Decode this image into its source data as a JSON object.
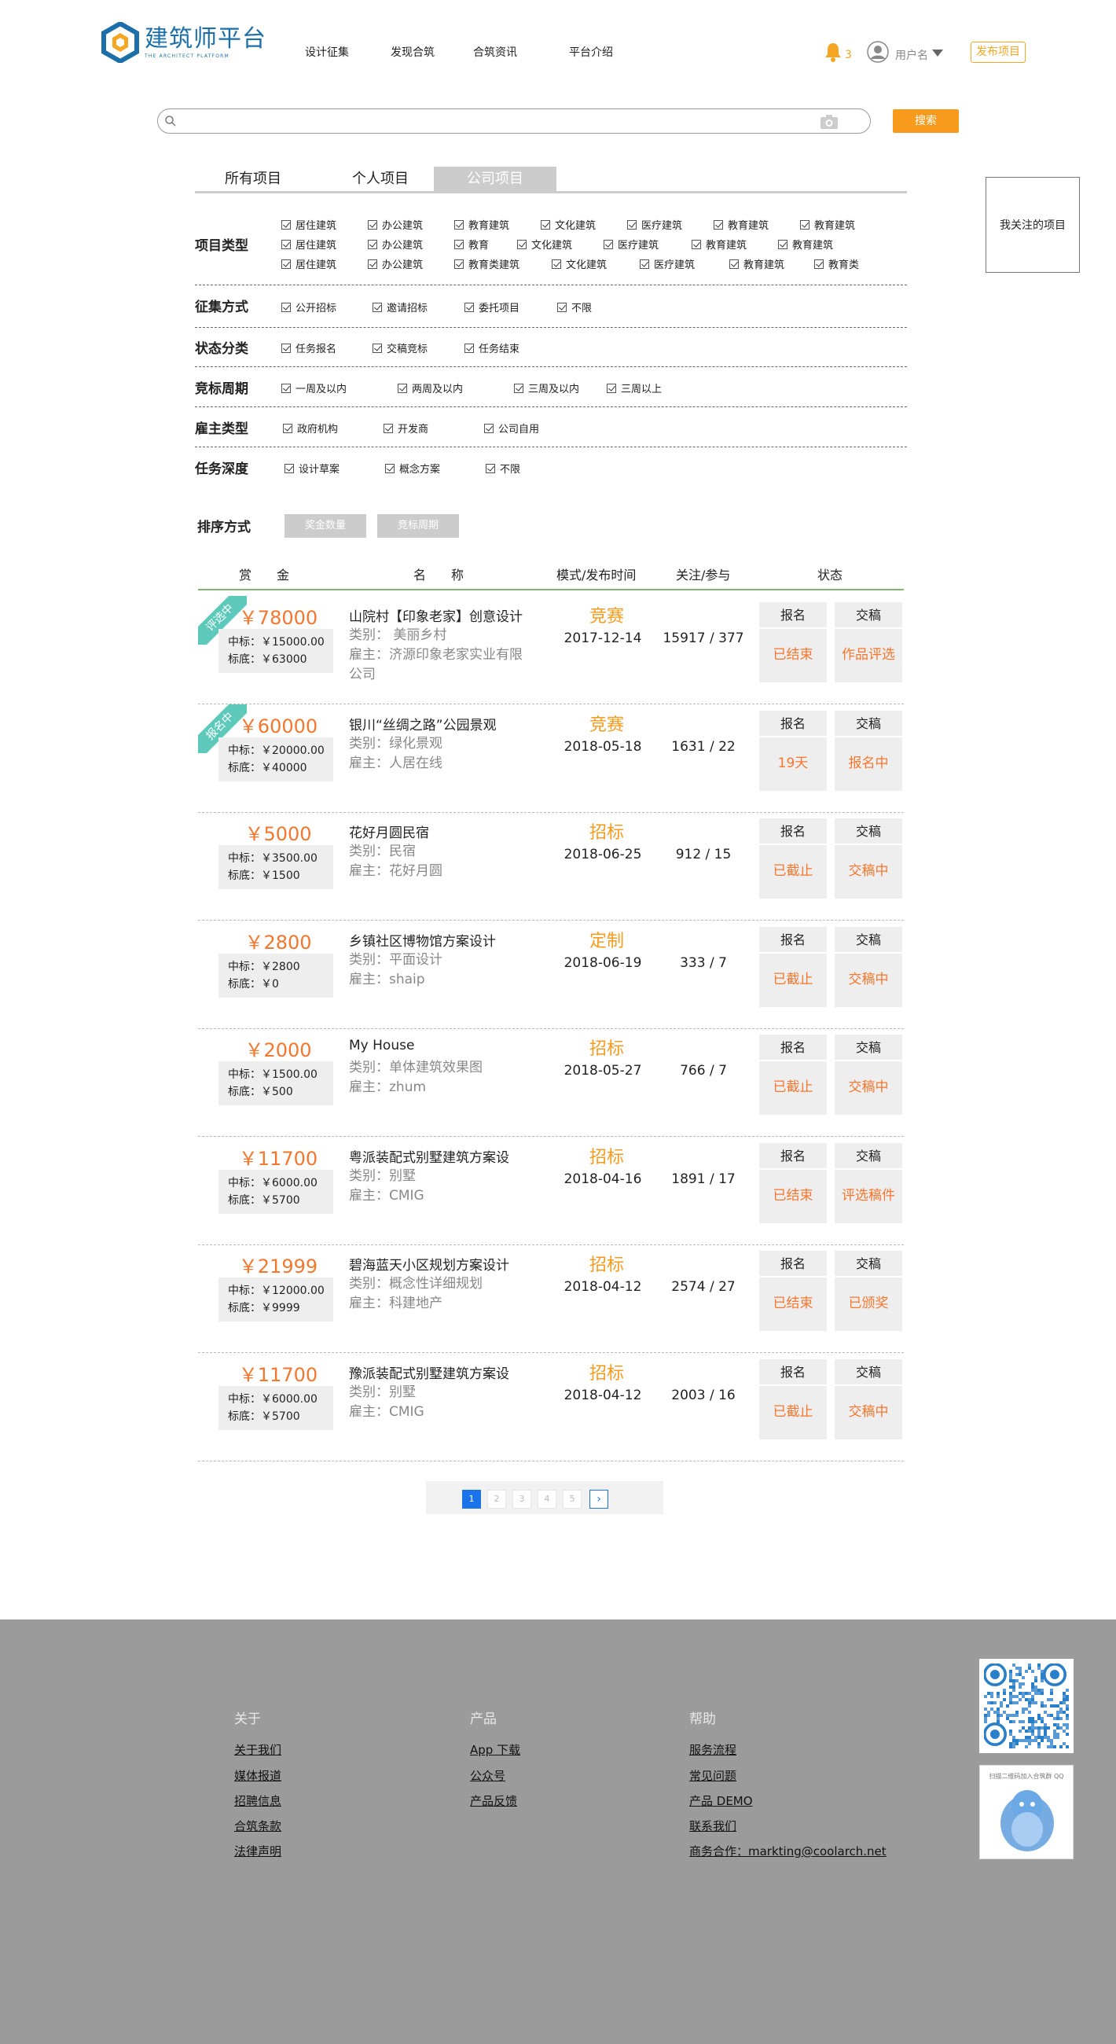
{
  "header": {
    "logo_cn": "建筑师平台",
    "logo_en": "THE ARCHITECT PLATFORM",
    "nav": [
      "设计征集",
      "发现合筑",
      "合筑资讯",
      "平台介绍"
    ],
    "notification_count": "3",
    "username": "用户名",
    "publish_label": "发布项目"
  },
  "search": {
    "placeholder": "",
    "button": "搜索"
  },
  "tabs": [
    "所有项目",
    "个人项目",
    "公司项目"
  ],
  "active_tab": "公司项目",
  "follow_box": "我关注的项目",
  "filters": {
    "project_type": {
      "label": "项目类型",
      "rows": [
        [
          "居住建筑",
          "办公建筑",
          "教育建筑",
          "文化建筑",
          "医疗建筑",
          "教育建筑",
          "教育建筑"
        ],
        [
          "居住建筑",
          "办公建筑",
          "教育",
          "文化建筑",
          "医疗建筑",
          "教育建筑",
          "教育建筑"
        ],
        [
          "居住建筑",
          "办公建筑",
          "教育类建筑",
          "文化建筑",
          "医疗建筑",
          "教育建筑",
          "教育类"
        ]
      ]
    },
    "collect_method": {
      "label": "征集方式",
      "options": [
        "公开招标",
        "邀请招标",
        "委托项目",
        "不限"
      ]
    },
    "status_type": {
      "label": "状态分类",
      "options": [
        "任务报名",
        "交稿竞标",
        "任务结束"
      ]
    },
    "bid_period": {
      "label": "竞标周期",
      "options": [
        "一周及以内",
        "两周及以内",
        "三周及以内",
        "三周以上"
      ]
    },
    "employer_type": {
      "label": "雇主类型",
      "options": [
        "政府机构",
        "开发商",
        "公司自用"
      ]
    },
    "task_depth": {
      "label": "任务深度",
      "options": [
        "设计草案",
        "概念方案",
        "不限"
      ]
    }
  },
  "sort": {
    "label": "排序方式",
    "options": [
      "奖金数量",
      "竞标周期"
    ]
  },
  "table_headers": {
    "reward": "赏　　金",
    "name": "名　　称",
    "mode_time": "模式/发布时间",
    "follow": "关注/参与",
    "status": "状态"
  },
  "projects": [
    {
      "ribbon": "评选中",
      "reward": "￥78000",
      "winning": "中标：￥15000.00",
      "base": "标底：￥63000",
      "title": "山院村【印象老家】创意设计",
      "category": "类别： 美丽乡村",
      "employer": "雇主：济源印象老家实业有限公司",
      "mode": "竞赛",
      "date": "2017-12-14",
      "counts": "15917 / 377",
      "signup_head": "报名",
      "signup_val": "已结束",
      "submit_head": "交稿",
      "submit_val": "作品评选"
    },
    {
      "ribbon": "报名中",
      "reward": "￥60000",
      "winning": "中标：￥20000.00",
      "base": "标底：￥40000",
      "title": "银川“丝绸之路”公园景观",
      "category": "类别：绿化景观",
      "employer": "雇主：人居在线",
      "mode": "竞赛",
      "date": "2018-05-18",
      "counts": "1631 / 22",
      "signup_head": "报名",
      "signup_val": "19天",
      "submit_head": "交稿",
      "submit_val": "报名中"
    },
    {
      "ribbon": "",
      "reward": "￥5000",
      "winning": "中标：￥3500.00",
      "base": "标底：￥1500",
      "title": "花好月圆民宿",
      "category": "类别：民宿",
      "employer": "雇主：花好月圆",
      "mode": "招标",
      "date": "2018-06-25",
      "counts": "912 / 15",
      "signup_head": "报名",
      "signup_val": "已截止",
      "submit_head": "交稿",
      "submit_val": "交稿中"
    },
    {
      "ribbon": "",
      "reward": "￥2800",
      "winning": "中标：￥2800",
      "base": "标底：￥0",
      "title": "乡镇社区博物馆方案设计",
      "category": "类别：平面设计",
      "employer": "雇主：shaip",
      "mode": "定制",
      "date": "2018-06-19",
      "counts": "333 / 7",
      "signup_head": "报名",
      "signup_val": "已截止",
      "submit_head": "交稿",
      "submit_val": "交稿中"
    },
    {
      "ribbon": "",
      "reward": "￥2000",
      "winning": "中标：￥1500.00",
      "base": "标底：￥500",
      "title": "My House",
      "category": "类别：单体建筑效果图",
      "employer": "雇主：zhum",
      "mode": "招标",
      "date": "2018-05-27",
      "counts": "766 / 7",
      "signup_head": "报名",
      "signup_val": "已截止",
      "submit_head": "交稿",
      "submit_val": "交稿中"
    },
    {
      "ribbon": "",
      "reward": "￥11700",
      "winning": "中标：￥6000.00",
      "base": "标底：￥5700",
      "title": "粤派装配式别墅建筑方案设",
      "category": "类别：别墅",
      "employer": "雇主：CMIG",
      "mode": "招标",
      "date": "2018-04-16",
      "counts": "1891 / 17",
      "signup_head": "报名",
      "signup_val": "已结束",
      "submit_head": "交稿",
      "submit_val": "评选稿件"
    },
    {
      "ribbon": "",
      "reward": "￥21999",
      "winning": "中标：￥12000.00",
      "base": "标底：￥9999",
      "title": "碧海蓝天小区规划方案设计",
      "category": "类别：概念性详细规划",
      "employer": "雇主：科建地产",
      "mode": "招标",
      "date": "2018-04-12",
      "counts": "2574 / 27",
      "signup_head": "报名",
      "signup_val": "已结束",
      "submit_head": "交稿",
      "submit_val": "已颁奖"
    },
    {
      "ribbon": "",
      "reward": "￥11700",
      "winning": "中标：￥6000.00",
      "base": "标底：￥5700",
      "title": "豫派装配式别墅建筑方案设",
      "category": "类别：别墅",
      "employer": "雇主：CMIG",
      "mode": "招标",
      "date": "2018-04-12",
      "counts": "2003 / 16",
      "signup_head": "报名",
      "signup_val": "已截止",
      "submit_head": "交稿",
      "submit_val": "交稿中"
    }
  ],
  "pagination": {
    "pages": [
      "1",
      "2",
      "3",
      "4",
      "5"
    ],
    "current": "1",
    "next": "›"
  },
  "footer": {
    "about": {
      "title": "关于",
      "links": [
        "关于我们",
        "媒体报道",
        "招聘信息",
        "合筑条款",
        "法律声明"
      ]
    },
    "product": {
      "title": "产品",
      "links": [
        "App 下载",
        "公众号",
        "产品反馈"
      ]
    },
    "help": {
      "title": "帮助",
      "links": [
        "服务流程",
        "常见问题",
        "产品 DEMO",
        "联系我们",
        "商务合作：markting@coolarch.net"
      ]
    },
    "qq_group_title": "扫描二维码加入合筑群 QQ"
  },
  "colors": {
    "accent": "#f89a1c",
    "reward": "#f5762d",
    "ribbon": "#5cc9ba",
    "footer_bg": "#9b9b9b",
    "brand": "#1c6fa8",
    "page_active": "#1a73e8"
  }
}
